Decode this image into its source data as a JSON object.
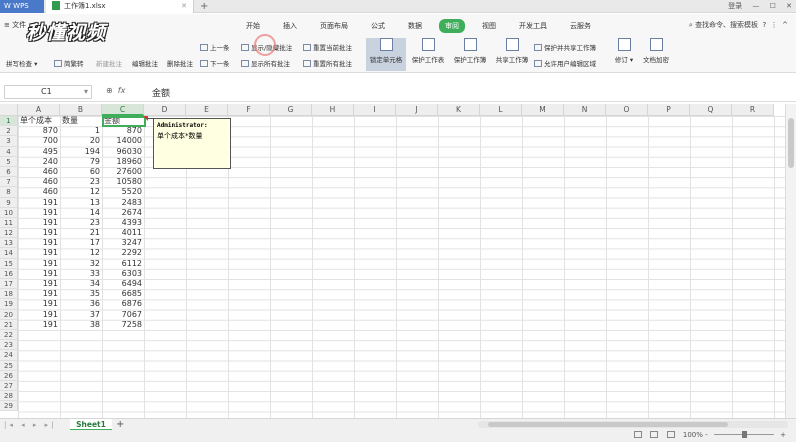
{
  "titlebar": {
    "app_name": "WPS",
    "file_name": "工作簿1.xlsx",
    "new_tab": "+",
    "login": "登录"
  },
  "menu": {
    "file": "≡ 文件",
    "tabs": [
      "开始",
      "插入",
      "页面布局",
      "公式",
      "数据",
      "审阅",
      "视图",
      "开发工具",
      "云服务"
    ],
    "active_tab": "审阅",
    "search": "查找命令、搜索模板"
  },
  "logo_text": "秒懂视频",
  "ribbon": {
    "spell_check": "拼写检查",
    "simp_trad": "简繁转",
    "new_comment": "新建批注",
    "edit_comment": "编辑批注",
    "delete_comment": "删除批注",
    "prev": "上一条",
    "next": "下一条",
    "show_hide_comment": "显示/隐藏批注",
    "show_all_comments": "显示所有批注",
    "reset_current_comment": "重置当前批注",
    "reset_all_comments": "重置所有批注",
    "lock_cell": "锁定单元格",
    "protect_sheet": "保护工作表",
    "protect_workbook": "保护工作簿",
    "share_workbook": "共享工作簿",
    "protect_share_workbook": "保护并共享工作簿",
    "allow_edit_ranges": "允许用户编辑区域",
    "track_changes": "修订",
    "doc_encrypt": "文档加密"
  },
  "formula": {
    "cell_ref": "C1",
    "fx": "fx",
    "content": "金额"
  },
  "columns": [
    "A",
    "B",
    "C",
    "D",
    "E",
    "F",
    "G",
    "H",
    "I",
    "J",
    "K",
    "L",
    "M",
    "N",
    "O",
    "P",
    "Q",
    "R"
  ],
  "rows": [
    "1",
    "2",
    "3",
    "4",
    "5",
    "6",
    "7",
    "8",
    "9",
    "10",
    "11",
    "12",
    "13",
    "14",
    "15",
    "16",
    "17",
    "18",
    "19",
    "20",
    "21",
    "22",
    "23",
    "24",
    "25",
    "26",
    "27",
    "28",
    "29"
  ],
  "table": {
    "headers": [
      "单个成本",
      "数量",
      "金额"
    ],
    "data": [
      [
        "870",
        "1",
        "870"
      ],
      [
        "700",
        "20",
        "14000"
      ],
      [
        "495",
        "194",
        "96030"
      ],
      [
        "240",
        "79",
        "18960"
      ],
      [
        "460",
        "60",
        "27600"
      ],
      [
        "460",
        "23",
        "10580"
      ],
      [
        "460",
        "12",
        "5520"
      ],
      [
        "191",
        "13",
        "2483"
      ],
      [
        "191",
        "14",
        "2674"
      ],
      [
        "191",
        "23",
        "4393"
      ],
      [
        "191",
        "21",
        "4011"
      ],
      [
        "191",
        "17",
        "3247"
      ],
      [
        "191",
        "12",
        "2292"
      ],
      [
        "191",
        "32",
        "6112"
      ],
      [
        "191",
        "33",
        "6303"
      ],
      [
        "191",
        "34",
        "6494"
      ],
      [
        "191",
        "35",
        "6685"
      ],
      [
        "191",
        "36",
        "6876"
      ],
      [
        "191",
        "37",
        "7067"
      ],
      [
        "191",
        "38",
        "7258"
      ]
    ]
  },
  "comment": {
    "author": "Administrator:",
    "text": "单个成本*数量"
  },
  "sheet_tab": "Sheet1",
  "add_sheet": "+",
  "status": {
    "zoom": "100%",
    "minus": "-",
    "plus": "+"
  }
}
